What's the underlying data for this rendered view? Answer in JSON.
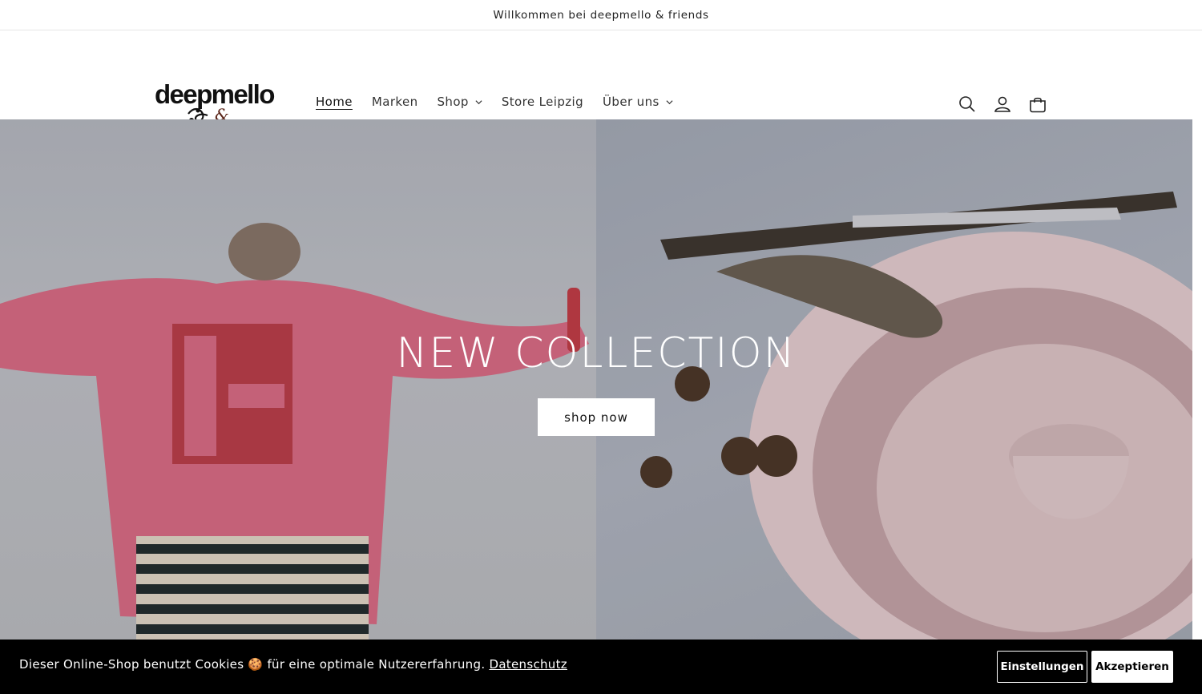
{
  "announcement": {
    "text": "Willkommen bei deepmello & friends"
  },
  "logo": {
    "wordmark": "deepmello",
    "submark": "& friends"
  },
  "nav": {
    "items": [
      {
        "label": "Home",
        "active": true,
        "dropdown": false
      },
      {
        "label": "Marken",
        "active": false,
        "dropdown": false
      },
      {
        "label": "Shop",
        "active": false,
        "dropdown": true
      },
      {
        "label": "Store Leipzig",
        "active": false,
        "dropdown": false
      },
      {
        "label": "Über uns",
        "active": false,
        "dropdown": true
      }
    ]
  },
  "header_icons": [
    "search-icon",
    "account-icon",
    "cart-icon"
  ],
  "hero": {
    "title": "NEW COLLECTION",
    "button": "shop now"
  },
  "cookie_banner": {
    "text_before": "Dieser Online-Shop benutzt Cookies",
    "emoji": "🍪",
    "text_after": "für eine optimale Nutzererfahrung.",
    "link": "Datenschutz",
    "settings_button": "Einstellungen",
    "accept_button": "Akzeptieren"
  },
  "colors": {
    "brand_dark": "#121212",
    "logo_accent": "#5a2418",
    "cookie_bg": "#000000"
  }
}
